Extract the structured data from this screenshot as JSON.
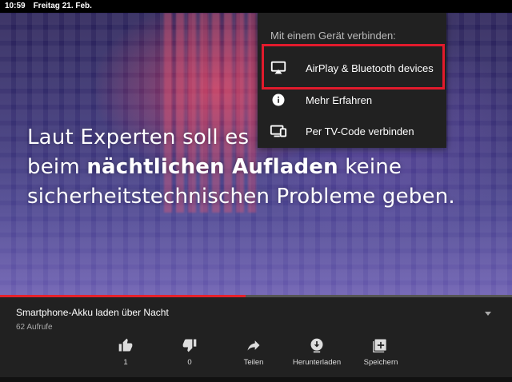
{
  "status_bar": {
    "time": "10:59",
    "date": "Freitag 21. Feb."
  },
  "video": {
    "caption_line1": "Laut Experten soll es",
    "caption_line2_pre": "beim ",
    "caption_line2_bold": "nächtlichen Aufladen",
    "caption_line2_post": " keine",
    "caption_line3": "sicherheitstechnischen Probleme geben.",
    "progress_fraction": 0.48
  },
  "cast_menu": {
    "header": "Mit einem Gerät verbinden:",
    "items": [
      {
        "label": "AirPlay & Bluetooth devices",
        "icon": "airplay-icon"
      },
      {
        "label": "Mehr Erfahren",
        "icon": "info-icon"
      },
      {
        "label": "Per TV-Code verbinden",
        "icon": "tv-code-icon"
      }
    ],
    "highlight_color": "#e21a2c"
  },
  "video_info": {
    "title": "Smartphone-Akku laden über Nacht",
    "views": "62 Aufrufe"
  },
  "actions": {
    "like_count": "1",
    "dislike_count": "0",
    "share_label": "Teilen",
    "download_label": "Herunterladen",
    "save_label": "Speichern"
  },
  "colors": {
    "accent": "#e5202a",
    "panel": "#212121"
  }
}
